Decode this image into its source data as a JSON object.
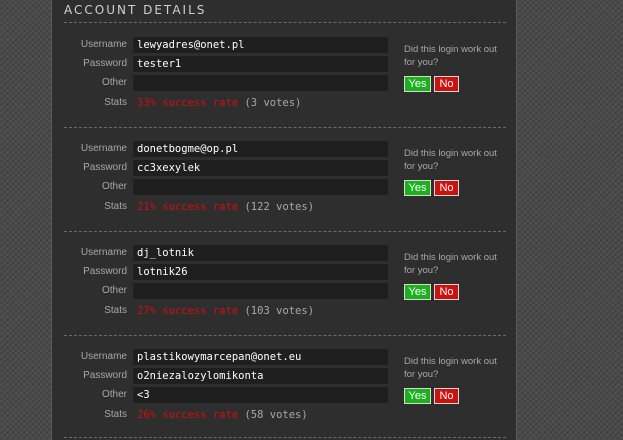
{
  "section": {
    "title": "ACCOUNT DETAILS"
  },
  "labels": {
    "username": "Username",
    "password": "Password",
    "other": "Other",
    "stats": "Stats"
  },
  "feedback": {
    "question": "Did this login work out for you?",
    "yes": "Yes",
    "no": "No"
  },
  "accounts": [
    {
      "username": "lewyadres@onet.pl",
      "password": "tester1",
      "other": "",
      "rate": "33% success rate",
      "votes": "(3 votes)"
    },
    {
      "username": "donetbogme@op.pl",
      "password": "cc3xexylek",
      "other": "",
      "rate": "21% success rate",
      "votes": "(122 votes)"
    },
    {
      "username": "dj_lotnik",
      "password": "lotnik26",
      "other": "",
      "rate": "27% success rate",
      "votes": "(103 votes)"
    },
    {
      "username": "plastikowymarcepan@onet.eu",
      "password": "o2niezalozylomikonta",
      "other": "<3",
      "rate": "26% success rate",
      "votes": "(58 votes)"
    }
  ],
  "colors": {
    "panel": "#2e2e2e",
    "field": "#1f1f1f",
    "yes": "#1db21d",
    "no": "#cc1111",
    "rate": "#cc1111"
  }
}
